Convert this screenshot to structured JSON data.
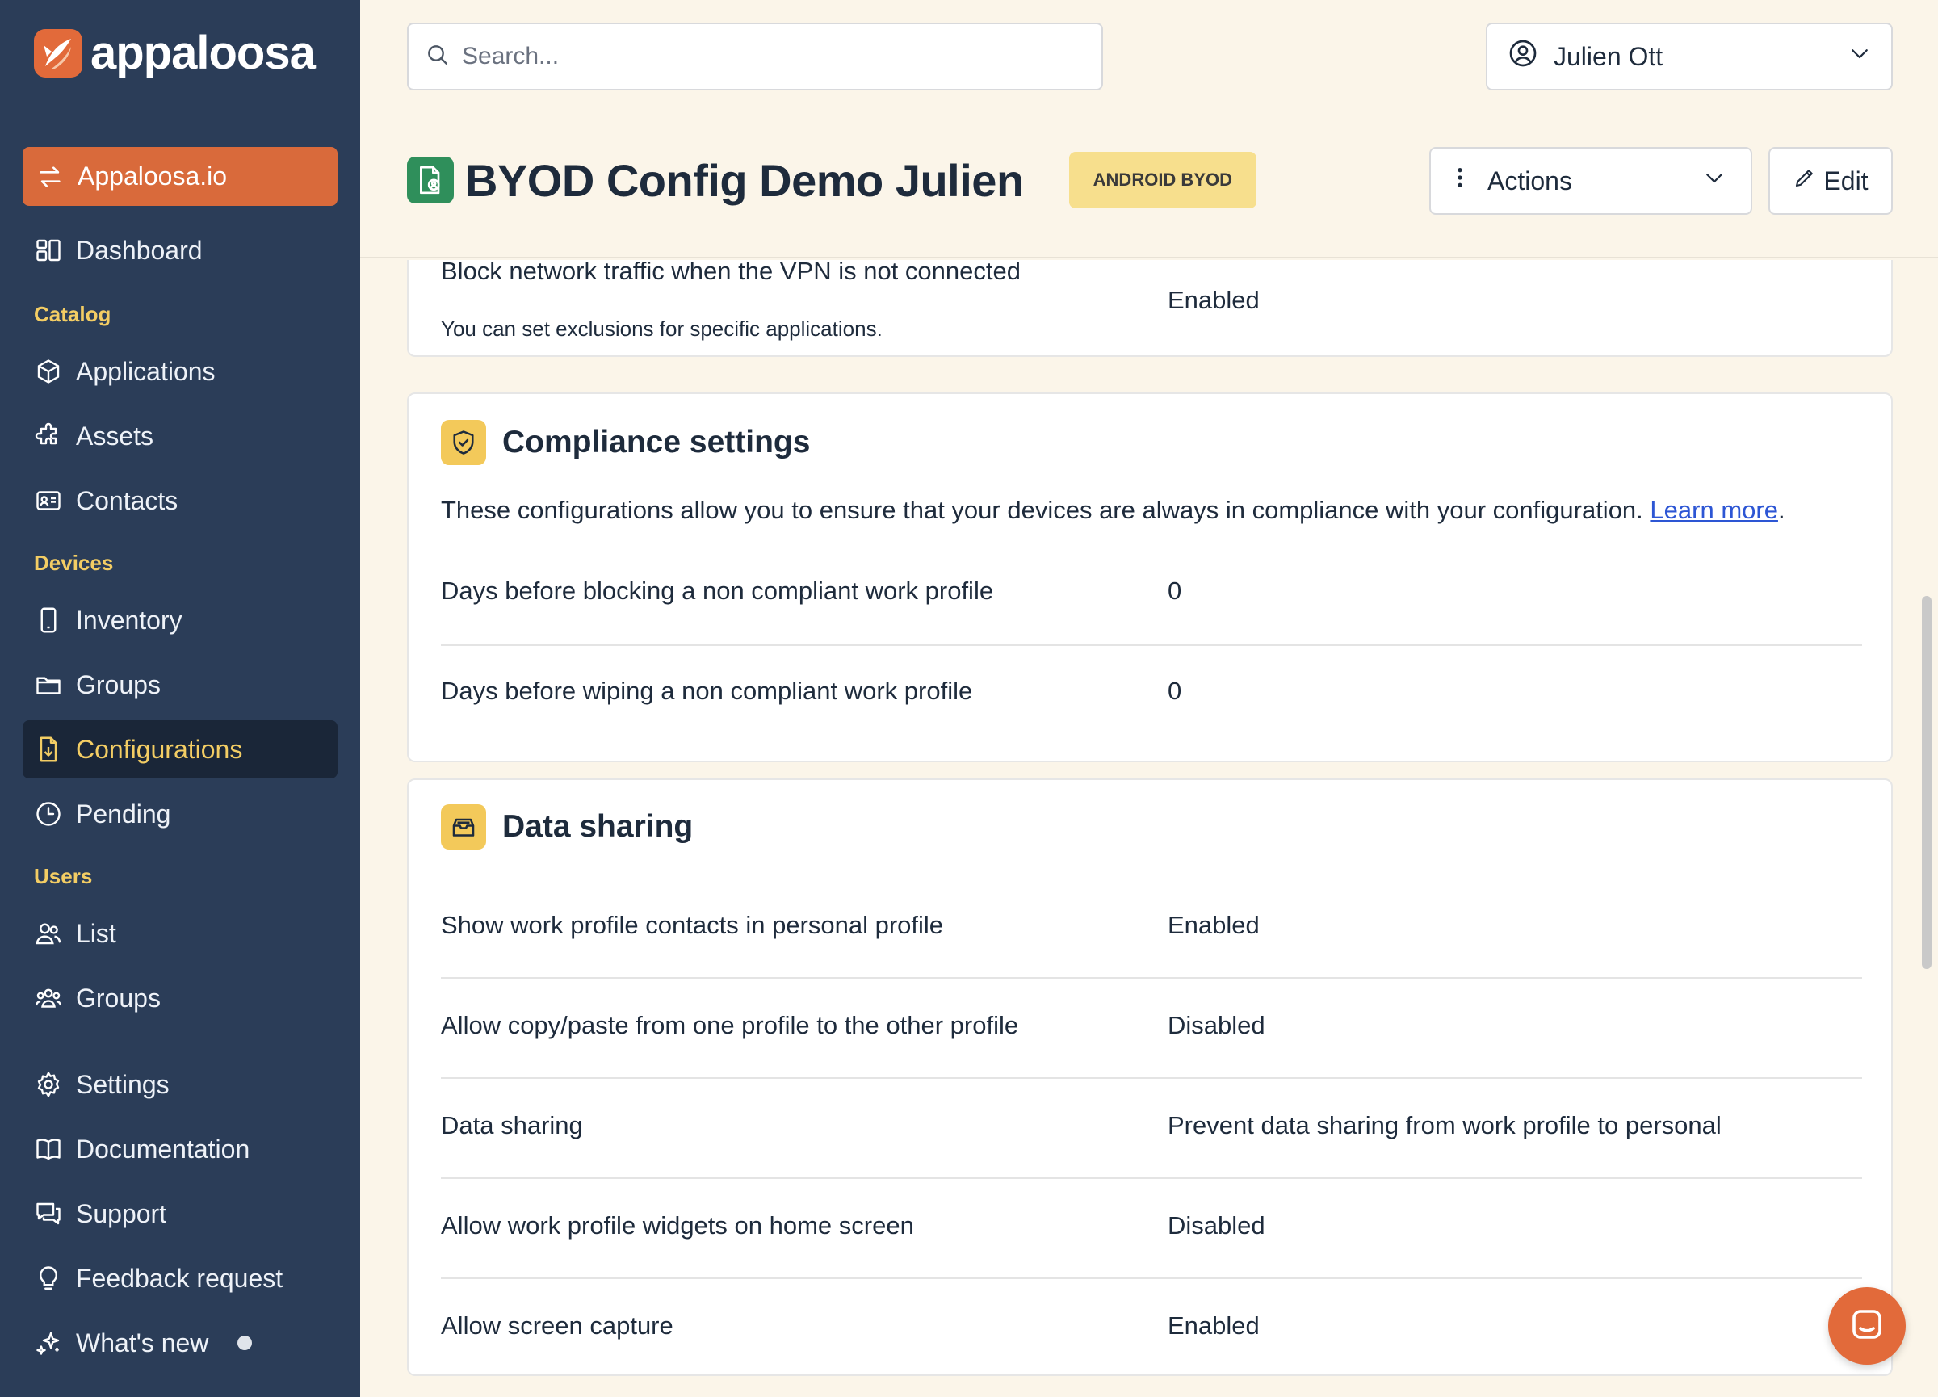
{
  "brand": {
    "name": "appaloosa",
    "accent": "#e26a3a",
    "sidebar_bg": "#2b3d58",
    "highlight": "#f3cd64"
  },
  "sidebar": {
    "org": "Appaloosa.io",
    "dashboard": "Dashboard",
    "sections": {
      "catalog": "Catalog",
      "devices": "Devices",
      "users": "Users"
    },
    "catalog_items": [
      "Applications",
      "Assets",
      "Contacts"
    ],
    "devices_items": [
      "Inventory",
      "Groups",
      "Configurations",
      "Pending"
    ],
    "users_items": [
      "List",
      "Groups"
    ],
    "footer_items": [
      "Settings",
      "Documentation",
      "Support",
      "Feedback request",
      "What's new"
    ]
  },
  "header": {
    "search_placeholder": "Search...",
    "user": "Julien Ott",
    "title": "BYOD Config Demo Julien",
    "badge": "ANDROID BYOD",
    "actions_label": "Actions",
    "edit_label": "Edit"
  },
  "vpn_card": {
    "cut_label": "Block network traffic when the VPN is not connected",
    "value": "Enabled",
    "note": "You can set exclusions for specific applications."
  },
  "compliance": {
    "title": "Compliance settings",
    "description": "These configurations allow you to ensure that your devices are always in compliance with your configuration.",
    "link": "Learn more",
    "rows": [
      {
        "label": "Days before blocking a non compliant work profile",
        "value": "0"
      },
      {
        "label": "Days before wiping a non compliant work profile",
        "value": "0"
      }
    ]
  },
  "data_sharing": {
    "title": "Data sharing",
    "rows": [
      {
        "label": "Show work profile contacts in personal profile",
        "value": "Enabled"
      },
      {
        "label": "Allow copy/paste from one profile to the other profile",
        "value": "Disabled"
      },
      {
        "label": "Data sharing",
        "value": "Prevent data sharing from work profile to personal"
      },
      {
        "label": "Allow work profile widgets on home screen",
        "value": "Disabled"
      },
      {
        "label": "Allow screen capture",
        "value": "Enabled"
      }
    ]
  }
}
